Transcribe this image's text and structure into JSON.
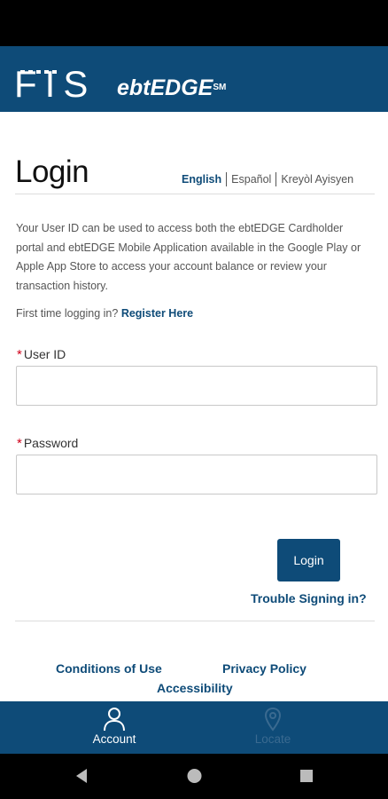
{
  "header": {
    "brand_fis": "FIS",
    "brand_product": "ebtEDGE",
    "brand_mark": "SM"
  },
  "page": {
    "title": "Login",
    "languages": [
      "English",
      "Español",
      "Kreyòl Ayisyen"
    ],
    "active_language": "English",
    "intro": "Your User ID can be used to access both the ebtEDGE Cardholder portal and ebtEDGE Mobile Application available in the Google Play or Apple App Store to access your account balance or review your transaction history.",
    "first_time_text": "First time logging in?",
    "register_link": "Register Here"
  },
  "form": {
    "required_marker": "*",
    "user_id_label": "User ID",
    "user_id_value": "",
    "password_label": "Password",
    "password_value": "",
    "login_button": "Login",
    "trouble_link": "Trouble Signing in?"
  },
  "footer": {
    "conditions": "Conditions of Use",
    "privacy": "Privacy Policy",
    "accessibility": "Accessibility"
  },
  "bottom_nav": {
    "items": [
      {
        "label": "Account",
        "icon": "person-icon",
        "active": true
      },
      {
        "label": "Locate",
        "icon": "location-pin-icon",
        "active": false
      }
    ]
  },
  "colors": {
    "brand_blue": "#0e4b78",
    "required_red": "#d0021b",
    "inactive_nav": "#3a6a90"
  }
}
